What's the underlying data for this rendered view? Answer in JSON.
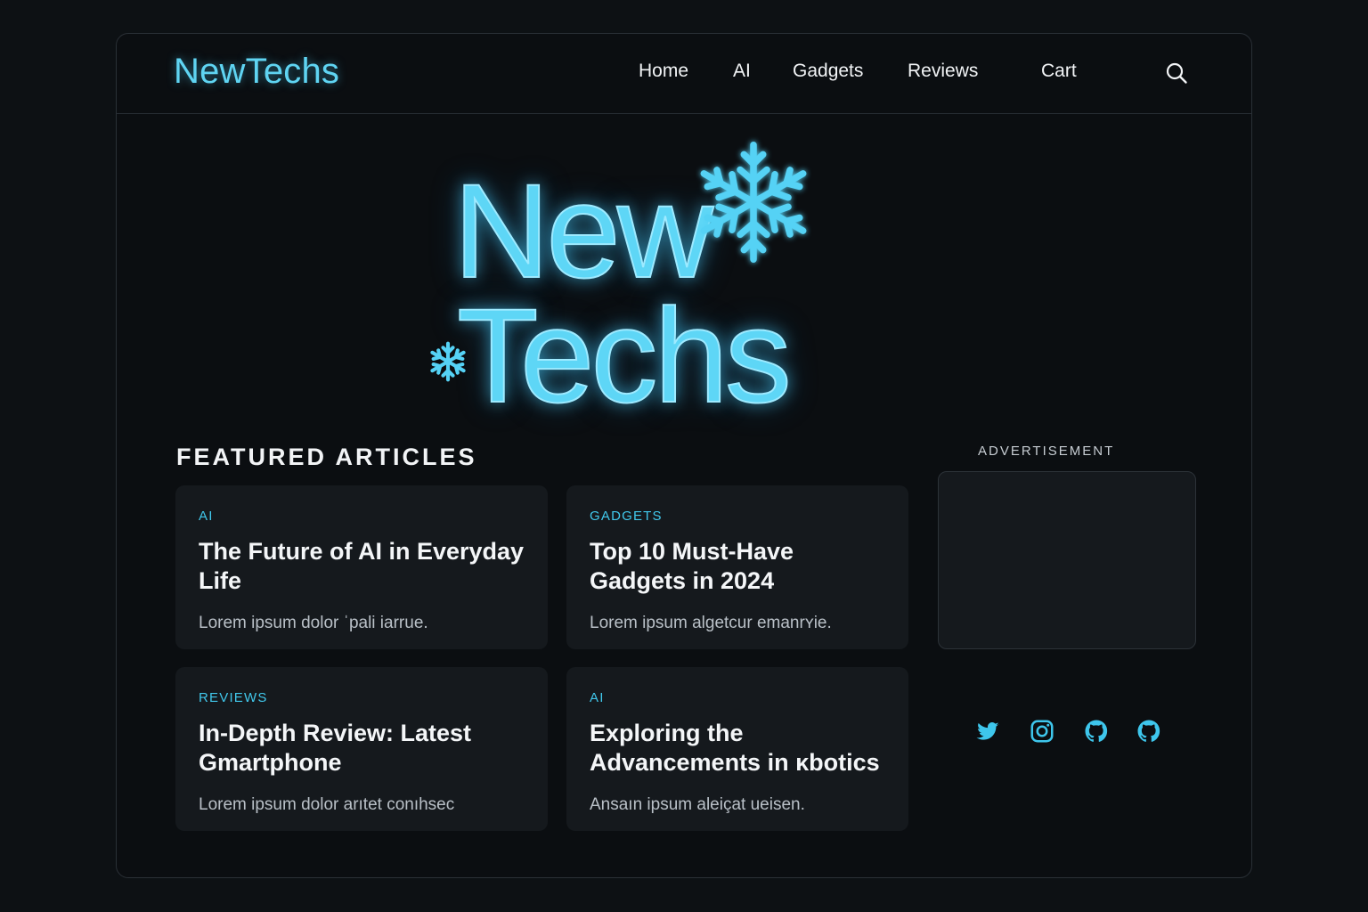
{
  "header": {
    "brand": "NewTechs",
    "nav": [
      "Home",
      "AI",
      "Gadgets",
      "Reviews",
      "Cart"
    ]
  },
  "hero": {
    "line1": "New",
    "line2": "Techs"
  },
  "featured": {
    "title": "FEATURED ARTICLES",
    "articles": [
      {
        "category": "AI",
        "title": "The Future of AI in Everyday Life",
        "excerpt": "Lorem ipsum dolor ˈpali iarrue."
      },
      {
        "category": "GADGETS",
        "title": "Top 10 Must-Have Gadgets in 2024",
        "excerpt": "Lorem ipsum algetcur emanrʏie."
      },
      {
        "category": "REVIEWS",
        "title": "In-Depth Review: Latest Gmartphone",
        "excerpt": "Lorem ipsum dolor arıtet conıhsec"
      },
      {
        "category": "AI",
        "title": "Exploring the Advancements in κbotics",
        "excerpt": "Ansaın ipsum aleiçat ueisen."
      }
    ]
  },
  "sidebar": {
    "ad_label": "ADVERTISEMENT",
    "social_icons": [
      "twitter-icon",
      "instagram-icon",
      "github-icon",
      "github-icon"
    ]
  },
  "colors": {
    "accent": "#41c8ec",
    "background": "#0b0e11",
    "card": "#15191d"
  }
}
